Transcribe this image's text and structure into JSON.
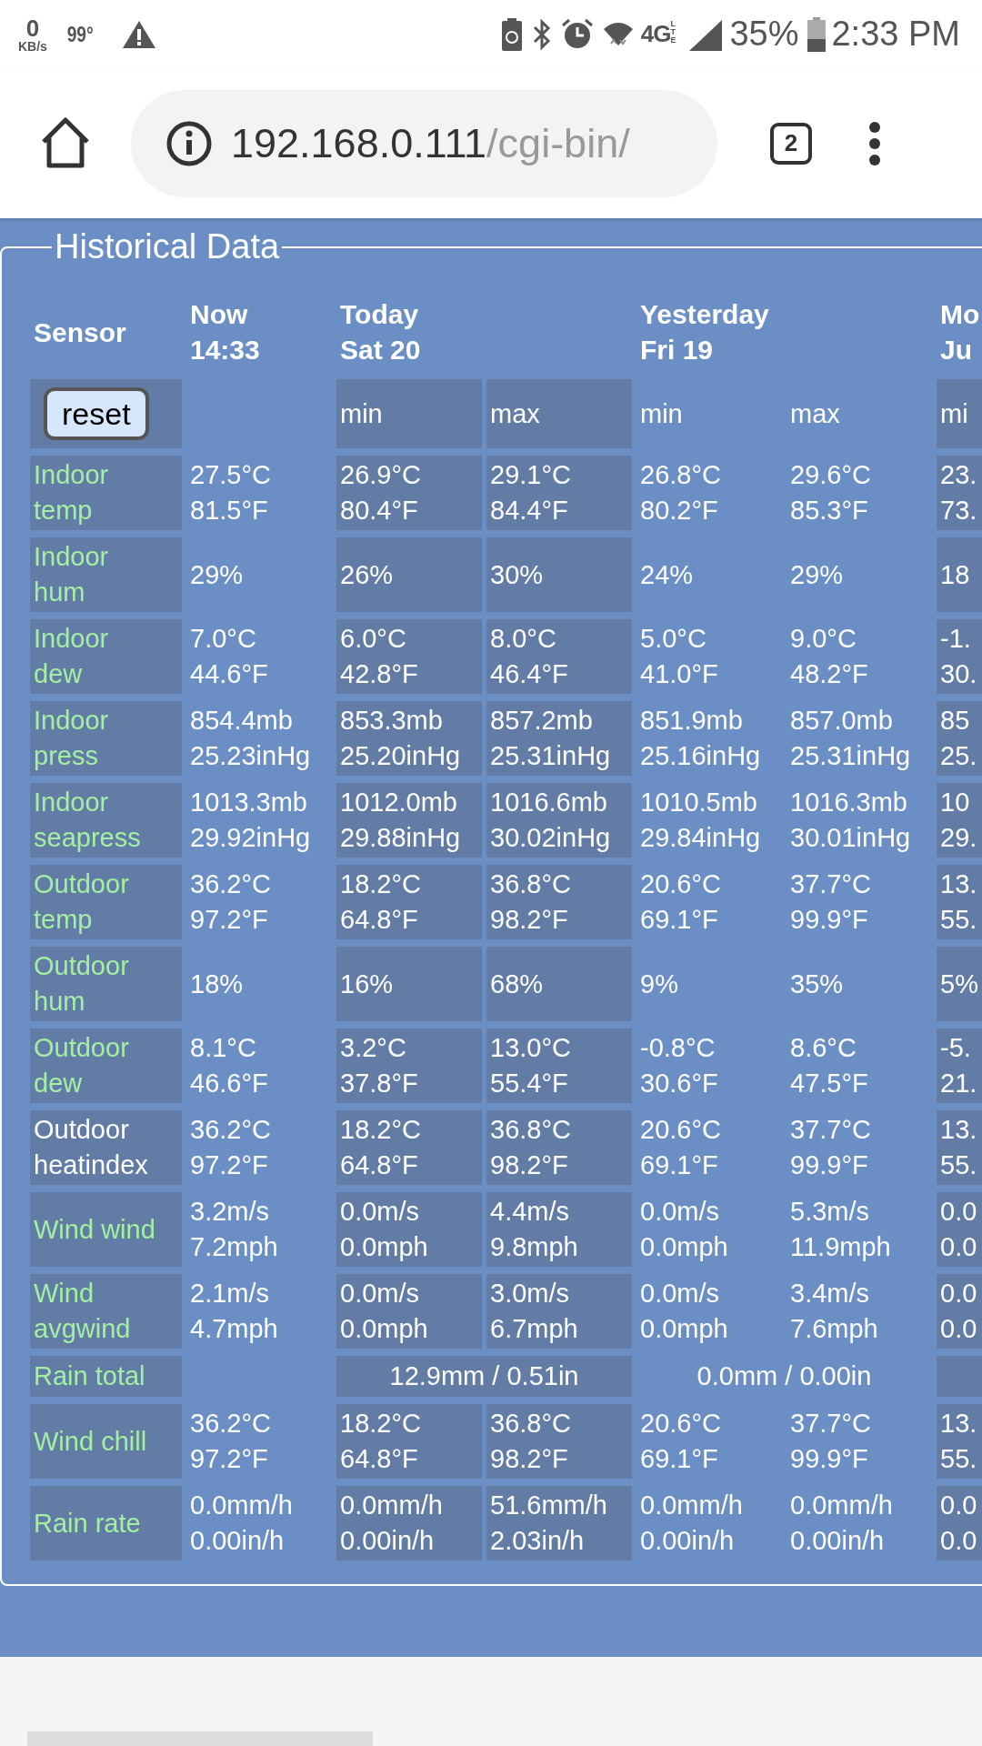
{
  "status_bar": {
    "net_speed": "0",
    "net_unit": "KB/s",
    "temperature": "99°",
    "network": "4G",
    "network_sub": "LTE",
    "battery": "35%",
    "time": "2:33 PM"
  },
  "browser": {
    "url_host": "192.168.0.111",
    "url_path": "/cgi-bin/",
    "tab_count": "2"
  },
  "panel": {
    "title": "Historical Data"
  },
  "table": {
    "sensor_heading": "Sensor",
    "reset_button": "reset",
    "groups": [
      {
        "title": "Now",
        "date": "14:33",
        "shaded": false
      },
      {
        "title": "Today",
        "date": "Sat 20",
        "shaded": true,
        "sub": [
          "min",
          "max"
        ]
      },
      {
        "title": "Yesterday",
        "date": "Fri 19",
        "shaded": false,
        "sub": [
          "min",
          "max"
        ]
      },
      {
        "title": "Mo",
        "date": "Ju",
        "shaded": true,
        "sub": [
          "mi"
        ]
      }
    ],
    "rows": [
      {
        "kind": "values",
        "sensor": [
          "Indoor",
          "temp"
        ],
        "highlighted": true,
        "values": [
          [
            "27.5°C",
            "81.5°F"
          ],
          [
            "26.9°C",
            "80.4°F"
          ],
          [
            "29.1°C",
            "84.4°F"
          ],
          [
            "26.8°C",
            "80.2°F"
          ],
          [
            "29.6°C",
            "85.3°F"
          ],
          [
            "23.",
            "73."
          ]
        ]
      },
      {
        "kind": "values",
        "sensor": [
          "Indoor",
          "hum"
        ],
        "highlighted": true,
        "values": [
          [
            "29%"
          ],
          [
            "26%"
          ],
          [
            "30%"
          ],
          [
            "24%"
          ],
          [
            "29%"
          ],
          [
            "18"
          ]
        ]
      },
      {
        "kind": "values",
        "sensor": [
          "Indoor",
          "dew"
        ],
        "highlighted": true,
        "values": [
          [
            "7.0°C",
            "44.6°F"
          ],
          [
            "6.0°C",
            "42.8°F"
          ],
          [
            "8.0°C",
            "46.4°F"
          ],
          [
            "5.0°C",
            "41.0°F"
          ],
          [
            "9.0°C",
            "48.2°F"
          ],
          [
            "-1.",
            "30."
          ]
        ]
      },
      {
        "kind": "values",
        "sensor": [
          "Indoor",
          "press"
        ],
        "highlighted": true,
        "values": [
          [
            "854.4mb",
            "25.23inHg"
          ],
          [
            "853.3mb",
            "25.20inHg"
          ],
          [
            "857.2mb",
            "25.31inHg"
          ],
          [
            "851.9mb",
            "25.16inHg"
          ],
          [
            "857.0mb",
            "25.31inHg"
          ],
          [
            "85",
            "25."
          ]
        ]
      },
      {
        "kind": "values",
        "sensor": [
          "Indoor",
          "seapress"
        ],
        "highlighted": true,
        "values": [
          [
            "1013.3mb",
            "29.92inHg"
          ],
          [
            "1012.0mb",
            "29.88inHg"
          ],
          [
            "1016.6mb",
            "30.02inHg"
          ],
          [
            "1010.5mb",
            "29.84inHg"
          ],
          [
            "1016.3mb",
            "30.01inHg"
          ],
          [
            "10",
            "29."
          ]
        ]
      },
      {
        "kind": "values",
        "sensor": [
          "Outdoor",
          "temp"
        ],
        "highlighted": true,
        "values": [
          [
            "36.2°C",
            "97.2°F"
          ],
          [
            "18.2°C",
            "64.8°F"
          ],
          [
            "36.8°C",
            "98.2°F"
          ],
          [
            "20.6°C",
            "69.1°F"
          ],
          [
            "37.7°C",
            "99.9°F"
          ],
          [
            "13.",
            "55."
          ]
        ]
      },
      {
        "kind": "values",
        "sensor": [
          "Outdoor",
          "hum"
        ],
        "highlighted": true,
        "values": [
          [
            "18%"
          ],
          [
            "16%"
          ],
          [
            "68%"
          ],
          [
            "9%"
          ],
          [
            "35%"
          ],
          [
            "5%"
          ]
        ]
      },
      {
        "kind": "values",
        "sensor": [
          "Outdoor",
          "dew"
        ],
        "highlighted": true,
        "values": [
          [
            "8.1°C",
            "46.6°F"
          ],
          [
            "3.2°C",
            "37.8°F"
          ],
          [
            "13.0°C",
            "55.4°F"
          ],
          [
            "-0.8°C",
            "30.6°F"
          ],
          [
            "8.6°C",
            "47.5°F"
          ],
          [
            "-5.",
            "21."
          ]
        ]
      },
      {
        "kind": "values",
        "sensor": [
          "Outdoor",
          "heatindex"
        ],
        "highlighted": false,
        "values": [
          [
            "36.2°C",
            "97.2°F"
          ],
          [
            "18.2°C",
            "64.8°F"
          ],
          [
            "36.8°C",
            "98.2°F"
          ],
          [
            "20.6°C",
            "69.1°F"
          ],
          [
            "37.7°C",
            "99.9°F"
          ],
          [
            "13.",
            "55."
          ]
        ]
      },
      {
        "kind": "values",
        "sensor": [
          "Wind wind"
        ],
        "highlighted": true,
        "values": [
          [
            "3.2m/s",
            "7.2mph"
          ],
          [
            "0.0m/s",
            "0.0mph"
          ],
          [
            "4.4m/s",
            "9.8mph"
          ],
          [
            "0.0m/s",
            "0.0mph"
          ],
          [
            "5.3m/s",
            "11.9mph"
          ],
          [
            "0.0",
            "0.0"
          ]
        ]
      },
      {
        "kind": "values",
        "sensor": [
          "Wind",
          "avgwind"
        ],
        "highlighted": true,
        "values": [
          [
            "2.1m/s",
            "4.7mph"
          ],
          [
            "0.0m/s",
            "0.0mph"
          ],
          [
            "3.0m/s",
            "6.7mph"
          ],
          [
            "0.0m/s",
            "0.0mph"
          ],
          [
            "3.4m/s",
            "7.6mph"
          ],
          [
            "0.0",
            "0.0"
          ]
        ]
      },
      {
        "kind": "totals",
        "sensor": [
          "Rain total"
        ],
        "highlighted": true,
        "cells": [
          {
            "kind": "empty"
          },
          {
            "kind": "text",
            "text": "12.9mm / 0.51in"
          },
          {
            "kind": "text",
            "text": "0.0mm / 0.00in"
          },
          {
            "kind": "empty"
          }
        ]
      },
      {
        "kind": "values",
        "sensor": [
          "Wind chill"
        ],
        "highlighted": true,
        "values": [
          [
            "36.2°C",
            "97.2°F"
          ],
          [
            "18.2°C",
            "64.8°F"
          ],
          [
            "36.8°C",
            "98.2°F"
          ],
          [
            "20.6°C",
            "69.1°F"
          ],
          [
            "37.7°C",
            "99.9°F"
          ],
          [
            "13.",
            "55."
          ]
        ]
      },
      {
        "kind": "values",
        "sensor": [
          "Rain rate"
        ],
        "highlighted": true,
        "values": [
          [
            "0.0mm/h",
            "0.00in/h"
          ],
          [
            "0.0mm/h",
            "0.00in/h"
          ],
          [
            "51.6mm/h",
            "2.03in/h"
          ],
          [
            "0.0mm/h",
            "0.00in/h"
          ],
          [
            "0.0mm/h",
            "0.00in/h"
          ],
          [
            "0.0",
            "0.0"
          ]
        ]
      }
    ]
  }
}
